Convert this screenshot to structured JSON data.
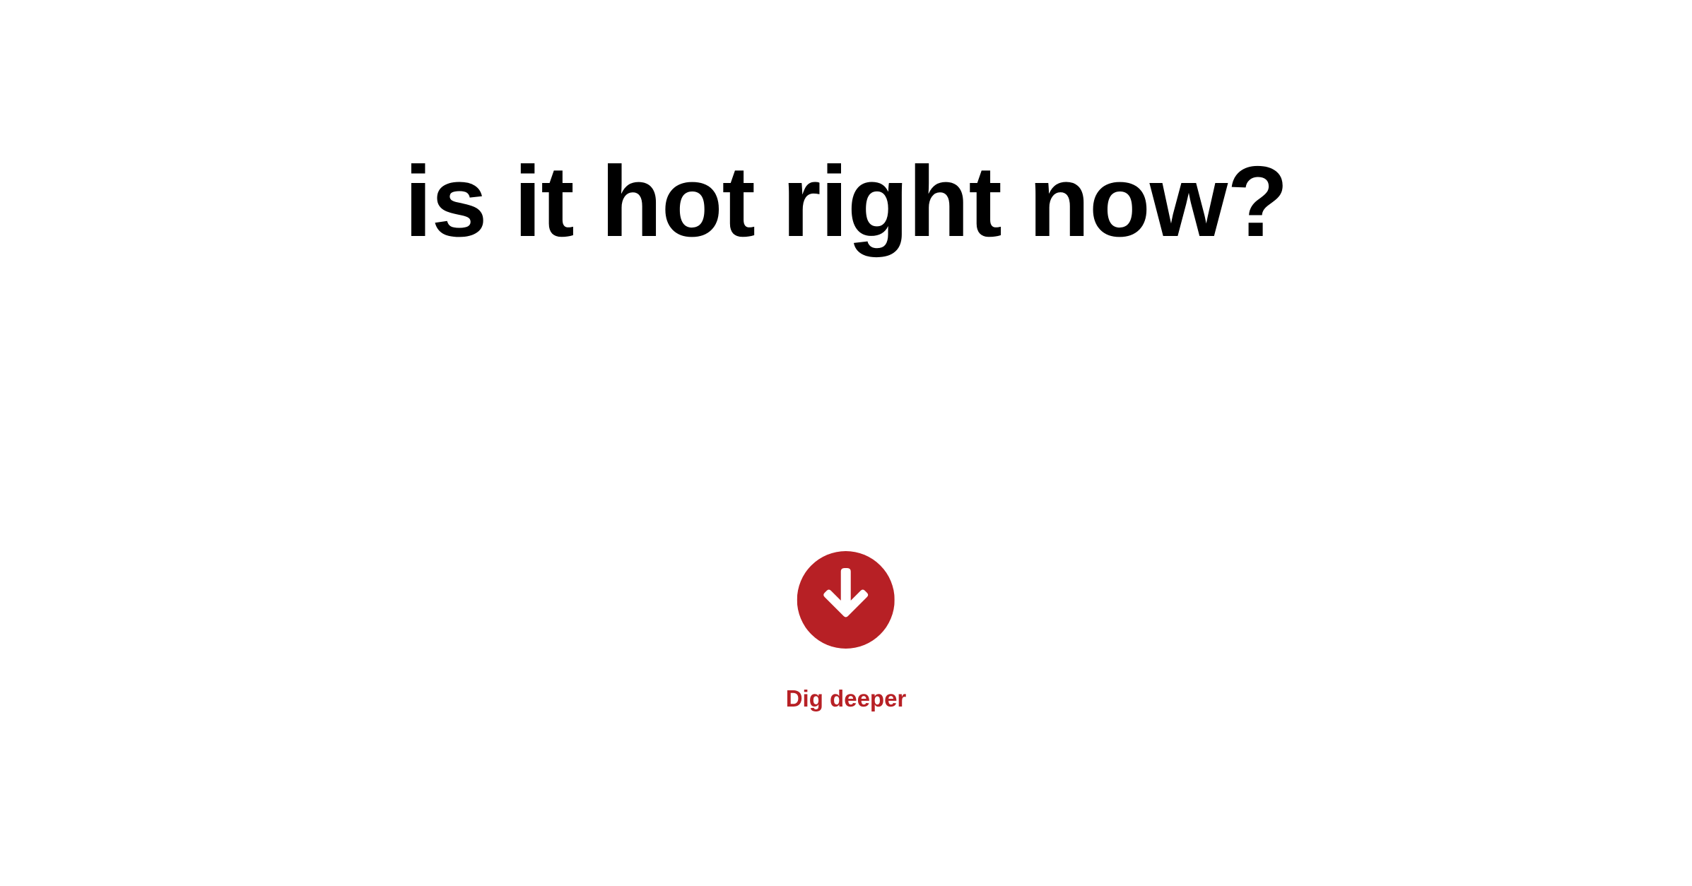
{
  "page": {
    "background": "#ffffff"
  },
  "headline": {
    "text": "is it hot right now?",
    "color": "#000000"
  },
  "dig_deeper": {
    "label": "Dig deeper",
    "icon": "arrow-down-circle-icon",
    "accent_color": "#b72025",
    "arrow_color": "#ffffff"
  }
}
